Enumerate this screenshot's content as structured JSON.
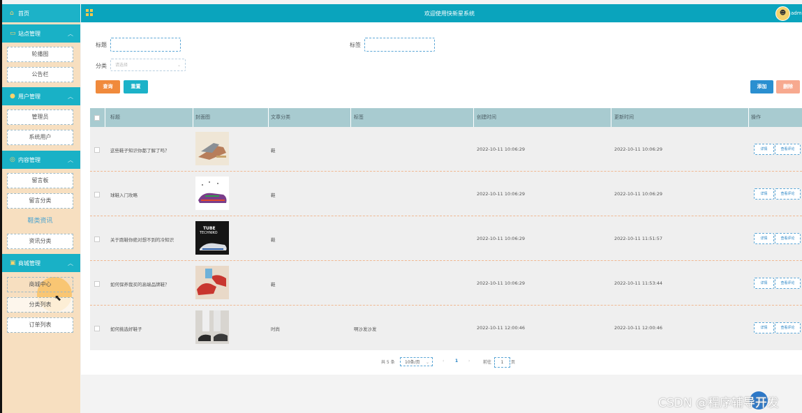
{
  "sidebar": {
    "home": "首页",
    "groups": [
      {
        "title": "站点管理",
        "items": [
          "轮播图",
          "公告栏"
        ]
      },
      {
        "title": "用户管理",
        "items": [
          "管理员",
          "系统用户"
        ]
      },
      {
        "title": "内容管理",
        "items": [
          "留言板",
          "留言分类",
          "鞋类资讯",
          "资讯分类"
        ]
      },
      {
        "title": "商城管理",
        "items": [
          "商城中心",
          "分类列表",
          "订单列表"
        ]
      }
    ],
    "active_item": "鞋类资讯"
  },
  "topbar": {
    "title": "欢迎使用快新星系统",
    "user": "adm"
  },
  "filters": {
    "title_label": "标题",
    "tag_label": "标签",
    "category_label": "分类",
    "category_placeholder": "请选择",
    "query_button": "查询",
    "reset_button": "重置",
    "add_button": "添加",
    "delete_button": "删除"
  },
  "table": {
    "columns": [
      "标题",
      "封面图",
      "文章分类",
      "标签",
      "创建时间",
      "更新时间",
      "操作"
    ],
    "rows": [
      {
        "title": "这些鞋子知识你都了解了吗？",
        "category": "鞋",
        "tag": "",
        "created": "2022-10-11 10:06:29",
        "updated": "2022-10-11 10:06:29"
      },
      {
        "title": "球鞋入门攻略",
        "category": "鞋",
        "tag": "",
        "created": "2022-10-11 10:06:29",
        "updated": "2022-10-11 10:06:29"
      },
      {
        "title": "关于跑鞋你绝对想不到的冷知识",
        "category": "鞋",
        "tag": "",
        "created": "2022-10-11 10:06:29",
        "updated": "2022-10-11 11:51:57"
      },
      {
        "title": "如何保养我买的高端品牌鞋？",
        "category": "鞋",
        "tag": "",
        "created": "2022-10-11 10:06:29",
        "updated": "2022-10-11 11:53:44"
      },
      {
        "title": "如何挑选好鞋子",
        "category": "时尚",
        "tag": "啊沙发沙发",
        "created": "2022-10-11 12:00:46",
        "updated": "2022-10-11 12:00:46"
      }
    ],
    "row_buttons": {
      "detail": "详情",
      "comments": "查看评论"
    }
  },
  "thumb_texts": {
    "row3_line1": "TUBE",
    "row3_line2": "TECHNIKO"
  },
  "pagination": {
    "total": "共 5 条",
    "page_size": "10条/页",
    "current": "1",
    "goto_prefix": "前往",
    "goto_value": "1",
    "goto_suffix": "页"
  },
  "watermark": "CSDN @程序辅导开发",
  "colors": {
    "primary": "#0aa4bd",
    "sidebar_bg": "#f7dfc0",
    "query": "#f08a3c",
    "reset": "#1cb2c8",
    "add": "#2a8fd0",
    "delete": "#f7a98f"
  }
}
